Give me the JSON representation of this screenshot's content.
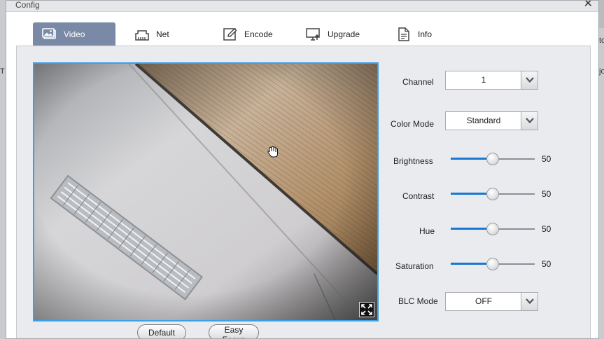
{
  "window": {
    "title": "Config"
  },
  "background_fragments": [
    "T",
    "to",
    "jo"
  ],
  "tabs": [
    {
      "label": "Video",
      "icon": "image-icon",
      "active": true
    },
    {
      "label": "Net",
      "icon": "network-port-icon",
      "active": false
    },
    {
      "label": "Encode",
      "icon": "edit-icon",
      "active": false
    },
    {
      "label": "Upgrade",
      "icon": "monitor-upload-icon",
      "active": false
    },
    {
      "label": "Info",
      "icon": "document-icon",
      "active": false
    }
  ],
  "preview": {
    "fullscreen_icon": "expand-icon",
    "cursor_icon": "hand-cursor-icon"
  },
  "buttons": {
    "default_label": "Default",
    "easy_focus_label": "Easy Focus"
  },
  "controls": {
    "channel": {
      "label": "Channel",
      "value": "1"
    },
    "color_mode": {
      "label": "Color Mode",
      "value": "Standard"
    },
    "brightness": {
      "label": "Brightness",
      "value": "50",
      "level": 50
    },
    "contrast": {
      "label": "Contrast",
      "value": "50",
      "level": 50
    },
    "hue": {
      "label": "Hue",
      "value": "50",
      "level": 50
    },
    "saturation": {
      "label": "Saturation",
      "value": "50",
      "level": 50
    },
    "blc_mode": {
      "label": "BLC Mode",
      "value": "OFF"
    }
  },
  "colors": {
    "tab_active": "#7a8aa6",
    "slider_fill": "#1877d3",
    "video_border": "#3aa0e8"
  }
}
